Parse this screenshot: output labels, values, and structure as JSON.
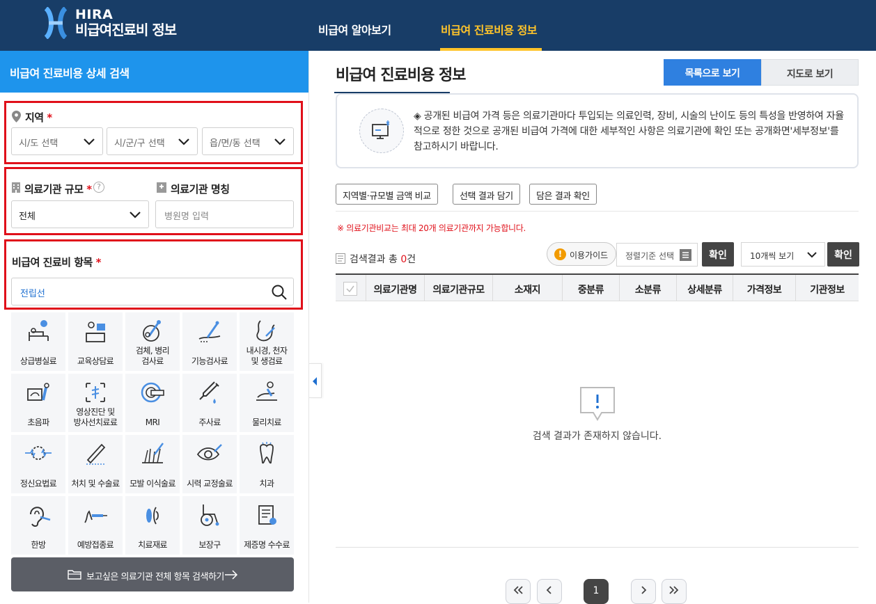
{
  "brand": {
    "line1": "HIRA",
    "line2": "비급여진료비 정보"
  },
  "nav": [
    {
      "label": "비급여 알아보기"
    },
    {
      "label": "비급여 진료비용 정보"
    }
  ],
  "sidebar": {
    "title": "비급여 진료비용 상세 검색",
    "region": {
      "label": "지역",
      "required": "*",
      "selects": [
        {
          "value": "시/도 선택"
        },
        {
          "value": "시/군/구 선택"
        },
        {
          "value": "읍/면/동 선택"
        }
      ]
    },
    "facility": {
      "scale_label": "의료기관 규모",
      "required": "*",
      "help": "?",
      "name_label": "의료기관 명칭",
      "scale_value": "전체",
      "name_placeholder": "병원명 입력"
    },
    "item": {
      "label": "비급여 진료비 항목",
      "required": "*",
      "value": "전립선"
    },
    "categories": [
      {
        "label": "상급병실료",
        "icon": "hospital-bed-icon"
      },
      {
        "label": "교육상담료",
        "icon": "counseling-icon"
      },
      {
        "label": "검체, 병리\n검사료",
        "icon": "microscope-icon"
      },
      {
        "label": "기능검사료",
        "icon": "function-test-icon"
      },
      {
        "label": "내시경, 천자\n및 생검료",
        "icon": "endoscope-icon"
      },
      {
        "label": "초음파",
        "icon": "ultrasound-icon"
      },
      {
        "label": "영상진단 및\n방사선치료료",
        "icon": "radiology-icon"
      },
      {
        "label": "MRI",
        "icon": "mri-icon"
      },
      {
        "label": "주사료",
        "icon": "syringe-icon"
      },
      {
        "label": "물리치료",
        "icon": "physical-therapy-icon"
      },
      {
        "label": "정신요법료",
        "icon": "brain-icon"
      },
      {
        "label": "처치 및 수술료",
        "icon": "scalpel-icon"
      },
      {
        "label": "모발 이식술료",
        "icon": "hair-transplant-icon"
      },
      {
        "label": "시력 교정술료",
        "icon": "eye-icon"
      },
      {
        "label": "치과",
        "icon": "tooth-icon"
      },
      {
        "label": "한방",
        "icon": "acupuncture-ear-icon"
      },
      {
        "label": "예방접종료",
        "icon": "vaccination-icon"
      },
      {
        "label": "치료재료",
        "icon": "lens-icon"
      },
      {
        "label": "보장구",
        "icon": "wheelchair-icon"
      },
      {
        "label": "제증명 수수료",
        "icon": "certificate-icon"
      }
    ],
    "search_all_button": "보고싶은 의료기관 전체 항목 검색하기"
  },
  "main": {
    "title": "비급여 진료비용 정보",
    "view_buttons": [
      {
        "label": "목록으로 보기"
      },
      {
        "label": "지도로 보기"
      }
    ],
    "notice": "◈ 공개된 비급여 가격 등은 의료기관마다 투입되는 의료인력, 장비, 시술의 난이도 등의 특성을 반영하여 자율적으로 정한 것으로 공개된 비급여 가격에 대한 세부적인 사항은 의료기관에 확인 또는 공개화면'세부정보'를 참고하시기 바랍니다.",
    "options": [
      {
        "label": "지역별·규모별 금액 비교"
      },
      {
        "label": "선택 결과 담기"
      },
      {
        "label": "담은 결과 확인"
      }
    ],
    "warning": "※ 의료기관비교는 최대 20개 의료기관까지 가능합니다.",
    "result_prefix": "검색결과 총",
    "result_count": "0",
    "result_suffix": "건",
    "guide_label": "이용가이드",
    "sort_placeholder": "정렬기준 선택",
    "confirm_label": "확인",
    "per_page": "10개씩 보기",
    "columns": [
      "의료기관명",
      "의료기관규모",
      "소재지",
      "중분류",
      "소분류",
      "상세분류",
      "가격정보",
      "기관정보"
    ],
    "empty_message": "검색 결과가 존재하지 않습니다.",
    "pagination": {
      "current": "1"
    }
  },
  "colors": {
    "header": "#183d67",
    "accent": "#1e94ec",
    "highlight": "#ffc42a",
    "required": "#e0101a"
  }
}
